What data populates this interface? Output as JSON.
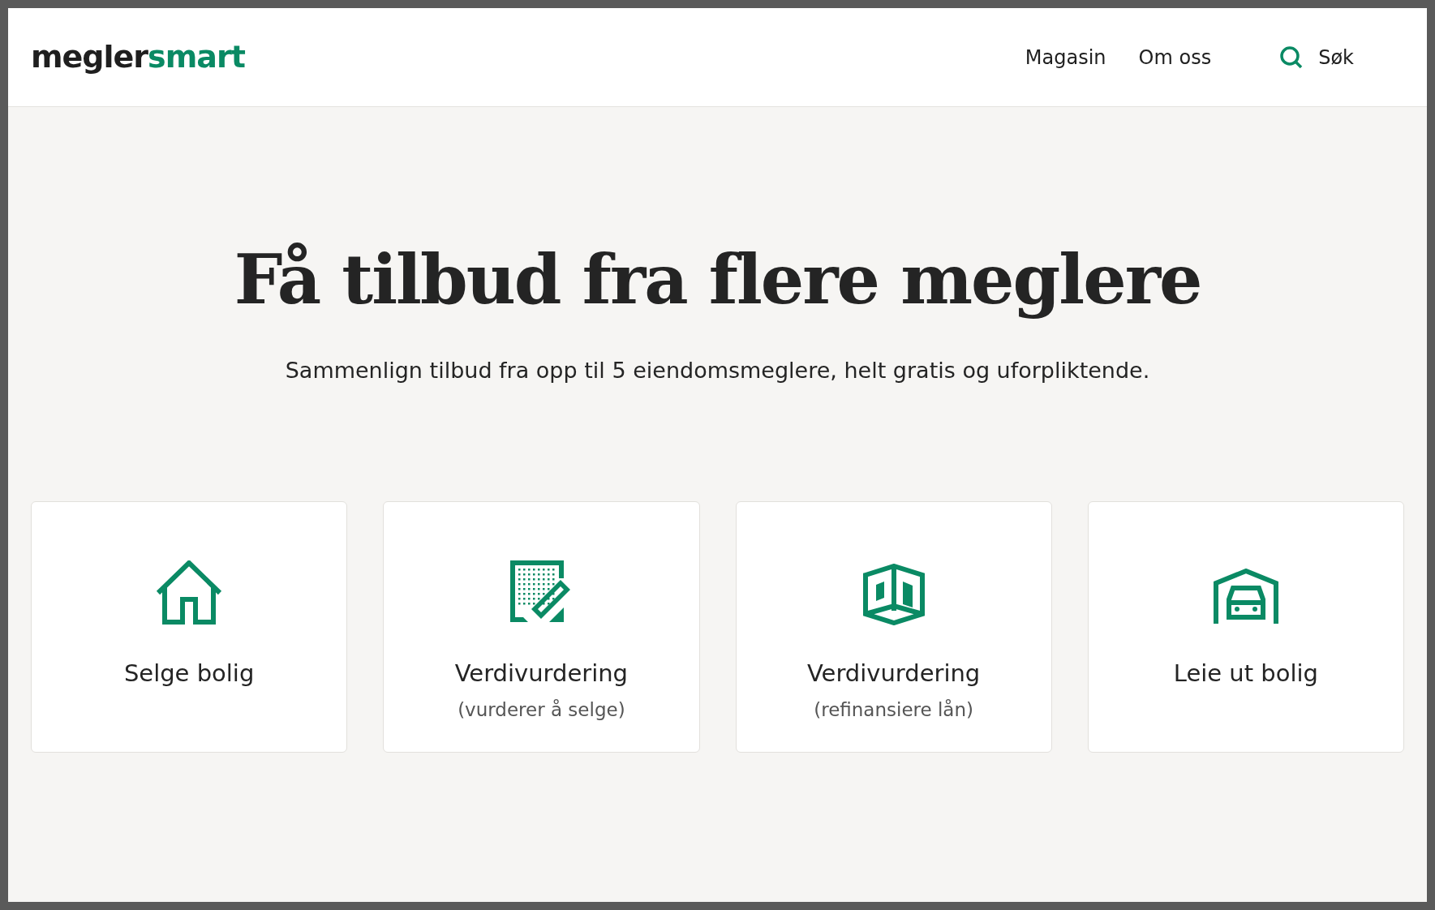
{
  "header": {
    "logo": [
      "megler",
      "smart"
    ],
    "nav": [
      "Magasin",
      "Om oss"
    ],
    "search": "Søk"
  },
  "hero": {
    "title": "Få tilbud fra flere meglere",
    "subtitle": "Sammenlign tilbud fra opp til 5 eiendomsmeglere, helt gratis og uforpliktende."
  },
  "cards": [
    {
      "title": "Selge bolig"
    },
    {
      "title": "Verdivurdering",
      "subtitle": "(vurderer å selge)"
    },
    {
      "title": "Verdivurdering",
      "subtitle": "(refinansiere lån)"
    },
    {
      "title": "Leie ut bolig"
    }
  ]
}
